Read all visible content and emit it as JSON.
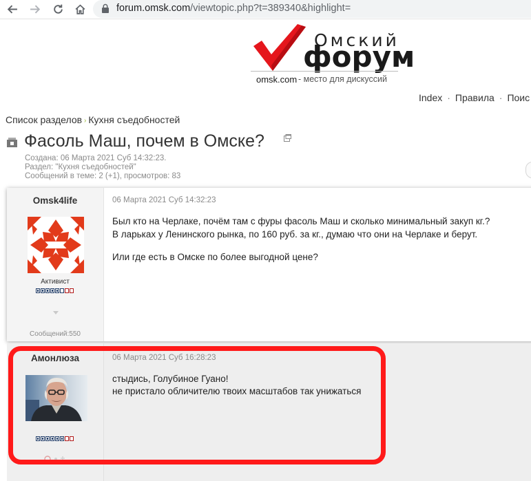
{
  "browser": {
    "url_host": "forum.omsk.com",
    "url_path": "/viewtopic.php?t=389340&highlight="
  },
  "logo": {
    "omsky": "Омский",
    "forum": "форум",
    "domain": "omsk.com",
    "tagline": "-  место для дискуссий",
    "colors": {
      "check": "#e5161c",
      "text": "#1a1a1a"
    }
  },
  "nav": {
    "items": [
      "Index",
      "Правила",
      "Поис"
    ]
  },
  "breadcrumb": {
    "items": [
      "Список разделов",
      "Кухня съедобностей"
    ]
  },
  "topic": {
    "title": "Фасоль Маш, почем в Омске?",
    "created": "Создана: 06 Марта 2021 Суб 14:32:23.",
    "section": "Раздел: \"Кухня съедобностей\"",
    "stats": "Сообщений в теме: 2 (+1), просмотров: 83"
  },
  "posts": [
    {
      "username": "Omsk4life",
      "rank": "Активист",
      "pips_filled": 5,
      "pips_total": 8,
      "message_count": "Сообщений:550",
      "date": "06 Марта 2021 Суб 14:32:23",
      "lines": [
        "Был кто на Черлаке, почём там с фуры фасоль Маш и сколько минимальный закуп кг.?",
        "В ларьках у Ленинского рынка, по 160 руб. за кг., думаю что они на Черлаке и берут.",
        "",
        "Или где есть в Омске по более выгодной цене?"
      ]
    },
    {
      "username": "Амонлюза",
      "pips_filled": 6,
      "pips_total": 8,
      "date": "06 Марта 2021 Суб 16:28:23",
      "lines": [
        "стыдись, Голубиное Гуано!",
        "не пристало обличителю твоих масштабов так унижаться"
      ]
    }
  ],
  "icons": {
    "back": "arrow-left-icon",
    "forward": "arrow-right-icon",
    "reload": "reload-icon",
    "home": "home-icon",
    "lock": "lock-icon"
  },
  "colors": {
    "highlight": "#ff1a1a",
    "pip": "#1f3b66",
    "avatar1": "#e23a1a"
  }
}
